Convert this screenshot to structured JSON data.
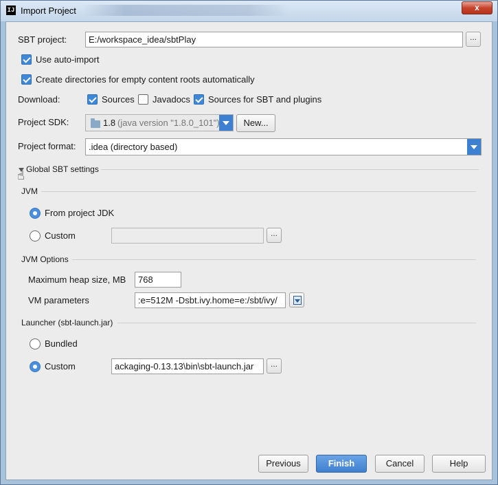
{
  "window": {
    "title": "Import Project",
    "close_label": "x"
  },
  "form": {
    "sbt_project_label": "SBT project:",
    "sbt_project_value": "E:/workspace_idea/sbtPlay",
    "browse_label": "...",
    "use_auto_import_label": "Use auto-import",
    "use_auto_import_checked": true,
    "create_dirs_label": "Create directories for empty content roots automatically",
    "create_dirs_checked": true,
    "download_label": "Download:",
    "download_sources_label": "Sources",
    "download_sources_checked": true,
    "download_javadocs_label": "Javadocs",
    "download_javadocs_checked": false,
    "download_sbt_sources_label": "Sources for SBT and plugins",
    "download_sbt_sources_checked": true,
    "project_sdk_label": "Project SDK:",
    "project_sdk_version": "1.8",
    "project_sdk_detail": "(java version \"1.8.0_101\")",
    "new_button_label": "New...",
    "project_format_label": "Project format:",
    "project_format_value": ".idea (directory based)"
  },
  "global_sbt": {
    "section_label": "Global SBT settings",
    "jvm_section": "JVM",
    "jvm_from_project_label": "From project JDK",
    "jvm_from_project_selected": true,
    "jvm_custom_label": "Custom",
    "jvm_custom_selected": false,
    "jvm_custom_path": "",
    "jvm_options_section": "JVM Options",
    "max_heap_label": "Maximum heap size, MB",
    "max_heap_value": "768",
    "vm_params_label": "VM parameters",
    "vm_params_value": ":e=512M -Dsbt.ivy.home=e:/sbt/ivy/",
    "launcher_section": "Launcher (sbt-launch.jar)",
    "launcher_bundled_label": "Bundled",
    "launcher_bundled_selected": false,
    "launcher_custom_label": "Custom",
    "launcher_custom_selected": true,
    "launcher_custom_path": "ackaging-0.13.13\\bin\\sbt-launch.jar"
  },
  "footer": {
    "previous_label": "Previous",
    "finish_label": "Finish",
    "cancel_label": "Cancel",
    "help_label": "Help"
  },
  "colors": {
    "accent": "#3f87d7",
    "dialog_bg": "#ececec",
    "title_bar": "#c4d6ea"
  }
}
